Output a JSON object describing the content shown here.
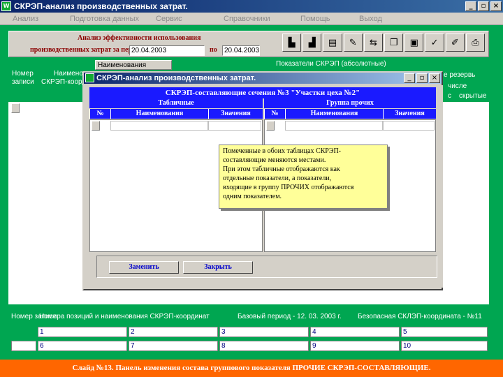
{
  "app": {
    "title": "СКРЭП-анализ производственных затрат.",
    "window_buttons": [
      "_",
      "▫",
      "×"
    ]
  },
  "menu": [
    "Анализ",
    "Подготовка данных",
    "Сервис",
    "Справочники",
    "Помощь",
    "Выход"
  ],
  "form": {
    "line1": "Анализ эффективности использования",
    "line2": "производственных затрат за период с",
    "date_from": "20.04.2003",
    "to_label": "по",
    "date_to": "20.04.2003"
  },
  "toolbar": {
    "icons": [
      "chart-bar-icon",
      "chart-bar2-icon",
      "document-icon",
      "tools-icon",
      "arrows-icon",
      "copy-icon",
      "disk-icon",
      "checkmark-icon",
      "edit-icon",
      "print-icon"
    ]
  },
  "grid_top": {
    "col_number": "Номер записи",
    "col_name_short": "Наименов.",
    "col_coord": "СКРЭП-коорд.",
    "name_header": "Наименования",
    "indicators": "Показатели СКРЭП (абсолютные)",
    "reserve": "е резервь",
    "in_number": "числе",
    "col_right1": "с",
    "col_right2": "скрытые"
  },
  "win2": {
    "title": "СКРЭП-анализ производственных затрат."
  },
  "dialog": {
    "header": "СКРЭП-составляющие сечения №3 \"Участки цеха №2\"",
    "left_title": "Табличные",
    "right_title": "Группа прочих",
    "col_no": "№",
    "col_name": "Наименования",
    "col_value": "Значения",
    "replace_btn": "Заменить",
    "close_btn": "Закрыть"
  },
  "tooltip": {
    "line1": "Помеченные в обоих таблицах СКРЭП-",
    "line2": "составляющие меняются местами.",
    "line3": "При этом табличные отображаются как",
    "line4": "отдельные показатели, а показатели,",
    "line5": "входящие в группу ПРОЧИХ отображаются",
    "line6": "одним показателем."
  },
  "bottom": {
    "col_number": "Номер записи",
    "col_positions": "Номера позиций и наименования СКРЭП-координат",
    "base_period": "Базовый период - 12. 03. 2003 г.",
    "zero_coord": "Безопасная СКЛЭП-координата - №11",
    "row1": [
      "1",
      "2",
      "3",
      "4",
      "5"
    ],
    "row2": [
      "6",
      "7",
      "8",
      "9",
      "10"
    ]
  },
  "caption": "Слайд №13. Панель изменения состава группового показателя ПРОЧИЕ СКРЭП-СОСТАВЛЯЮЩИЕ."
}
